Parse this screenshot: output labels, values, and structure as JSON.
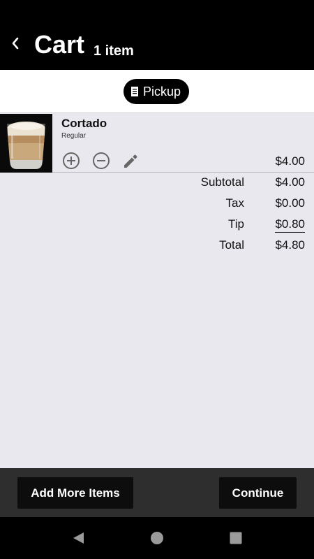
{
  "header": {
    "title": "Cart",
    "item_count": "1 item"
  },
  "order_mode": {
    "label": "Pickup",
    "icon": "receipt-icon"
  },
  "cart": {
    "items": [
      {
        "name": "Cortado",
        "size": "Regular",
        "price": "$4.00",
        "image": "cortado-drink-image"
      }
    ]
  },
  "totals": {
    "subtotal_label": "Subtotal",
    "subtotal_value": "$4.00",
    "tax_label": "Tax",
    "tax_value": "$0.00",
    "tip_label": "Tip",
    "tip_value": "$0.80",
    "total_label": "Total",
    "total_value": "$4.80"
  },
  "actions": {
    "add_more_label": "Add More Items",
    "continue_label": "Continue"
  },
  "colors": {
    "header_bg": "#000000",
    "page_bg": "#e9e8ee",
    "bottom_bar_bg": "#2e2e2e",
    "button_bg": "#0d0d0d"
  }
}
